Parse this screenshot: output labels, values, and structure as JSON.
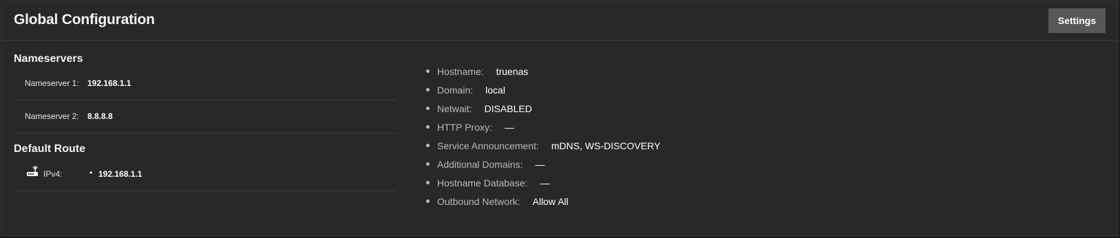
{
  "header": {
    "title": "Global Configuration",
    "settings_label": "Settings"
  },
  "nameservers": {
    "title": "Nameservers",
    "items": [
      {
        "label": "Nameserver 1:",
        "value": "192.168.1.1"
      },
      {
        "label": "Nameserver 2:",
        "value": "8.8.8.8"
      }
    ]
  },
  "default_route": {
    "title": "Default Route",
    "label": "IPv4:",
    "bullet": "•",
    "value": "192.168.1.1",
    "icon": "router-icon"
  },
  "info": [
    {
      "key": "Hostname:",
      "value": "truenas"
    },
    {
      "key": "Domain:",
      "value": "local"
    },
    {
      "key": "Netwait:",
      "value": "DISABLED"
    },
    {
      "key": "HTTP Proxy:",
      "value": "—"
    },
    {
      "key": "Service Announcement:",
      "value": "mDNS, WS-DISCOVERY"
    },
    {
      "key": "Additional Domains:",
      "value": "—"
    },
    {
      "key": "Hostname Database:",
      "value": "—"
    },
    {
      "key": "Outbound Network:",
      "value": "Allow All"
    }
  ],
  "colors": {
    "background": "#282828",
    "button": "#575757",
    "divider": "#3d3d3d"
  }
}
